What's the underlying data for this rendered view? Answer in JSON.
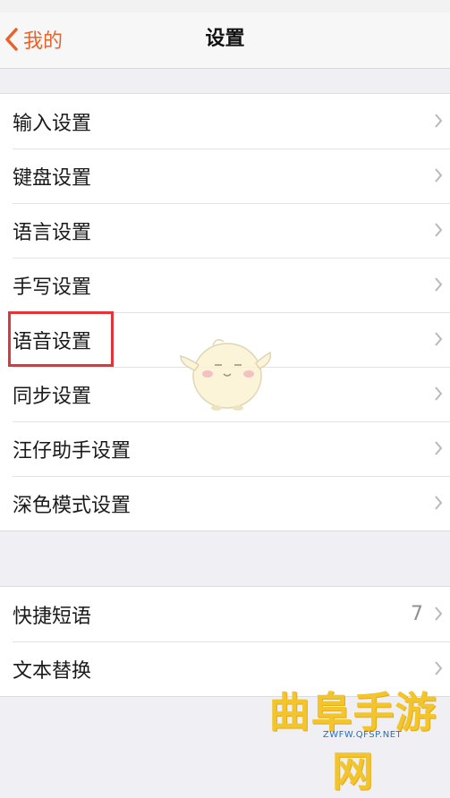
{
  "nav": {
    "back_label": "我的",
    "title": "设置"
  },
  "group1": {
    "items": [
      {
        "label": "输入设置"
      },
      {
        "label": "键盘设置"
      },
      {
        "label": "语言设置"
      },
      {
        "label": "手写设置"
      },
      {
        "label": "语音设置"
      },
      {
        "label": "同步设置"
      },
      {
        "label": "汪仔助手设置"
      },
      {
        "label": "深色模式设置"
      }
    ]
  },
  "group2": {
    "items": [
      {
        "label": "快捷短语",
        "value": "7"
      },
      {
        "label": "文本替换"
      }
    ]
  },
  "watermark": {
    "text": "曲阜手游网",
    "url": "ZWFW.QFSP.NET"
  },
  "colors": {
    "accent": "#e8622a",
    "highlight": "#e0363a",
    "watermark": "#f3c52d"
  }
}
